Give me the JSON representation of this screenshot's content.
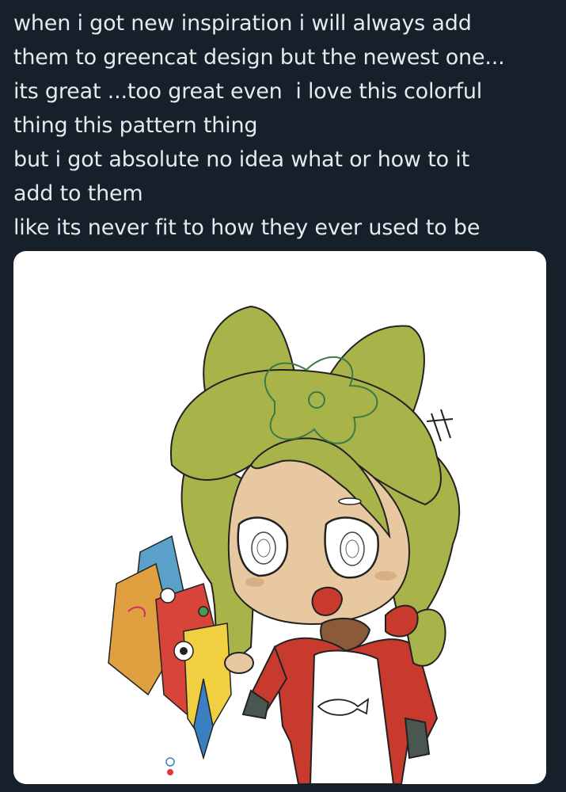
{
  "post": {
    "text_lines": [
      "when i got new inspiration i will always add",
      "them to greencat design but the newest one...",
      "its great ...too great even  i love this colorful",
      "thing this pattern thing",
      "but i got absolute no idea what or how to it",
      "add to them",
      "like its never fit to how they ever used to be"
    ]
  },
  "media": {
    "kind": "drawing",
    "subject": "chibi green-haired cat-eared character holding a colorful patterned object"
  },
  "colors": {
    "background": "#15202b",
    "text": "#e7e9ea",
    "card": "#ffffff",
    "hair": "#a8b44a",
    "skin": "#e8c8a0",
    "jacket": "#c83a2e"
  }
}
